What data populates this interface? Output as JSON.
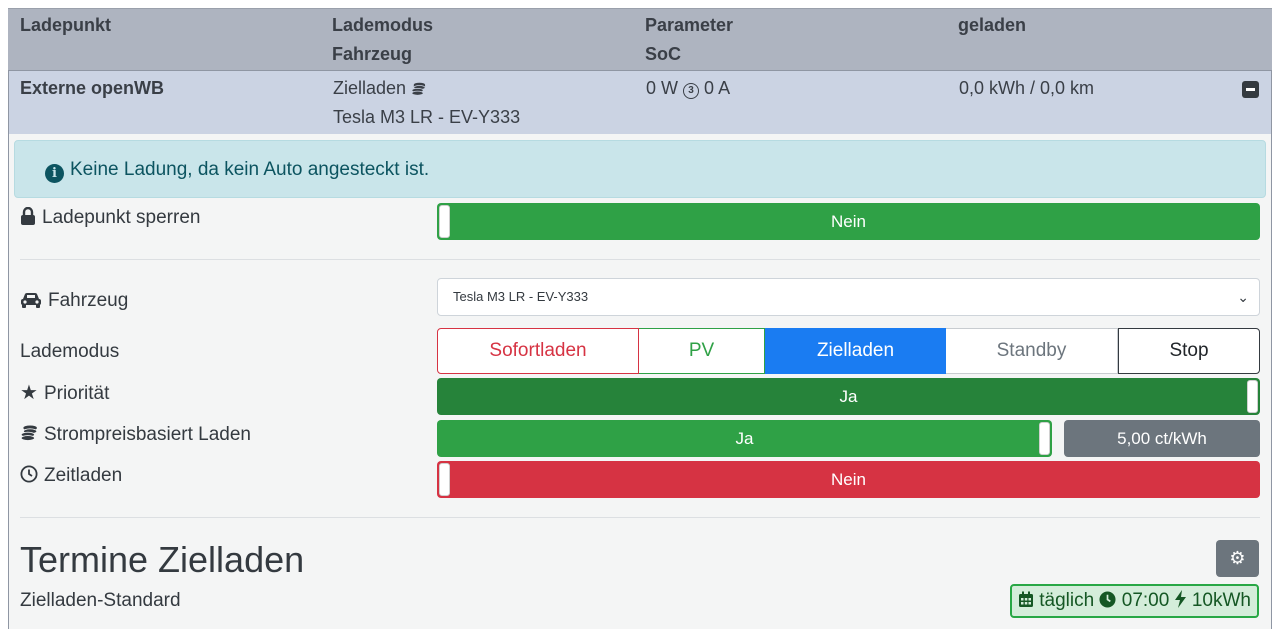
{
  "header": {
    "col1": "Ladepunkt",
    "col2_line1": "Lademodus",
    "col2_line2": "Fahrzeug",
    "col3_line1": "Parameter",
    "col3_line2": "SoC",
    "col4": "geladen"
  },
  "row": {
    "chargepoint": "Externe openWB",
    "mode": "Zielladen",
    "mode_icon": "coins-icon",
    "vehicle": "Tesla M3 LR - EV-Y333",
    "power": "0 W",
    "phases_icon": "3",
    "current": "0 A",
    "charged": "0,0 kWh / 0,0 km"
  },
  "alert": {
    "text": "Keine Ladung, da kein Auto angesteckt ist."
  },
  "settings": {
    "lock_label": "Ladepunkt sperren",
    "lock_value": "Nein",
    "vehicle_label": "Fahrzeug",
    "vehicle_selected": "Tesla M3 LR - EV-Y333",
    "mode_label": "Lademodus",
    "modes": [
      "Sofortladen",
      "PV",
      "Zielladen",
      "Standby",
      "Stop"
    ],
    "mode_active": "Zielladen",
    "priority_label": "Priorität",
    "priority_value": "Ja",
    "price_label": "Strompreisbasiert Laden",
    "price_value": "Ja",
    "price_limit": "5,00 ct/kWh",
    "time_label": "Zeitladen",
    "time_value": "Nein"
  },
  "plans": {
    "title": "Termine Zielladen",
    "subtitle": "Zielladen-Standard",
    "badge_freq": "täglich",
    "badge_time": "07:00",
    "badge_energy": "10kWh"
  },
  "colors": {
    "green": "#2fa146",
    "dark_green": "#26833a",
    "red": "#d63343",
    "blue": "#1a7cf2",
    "gray": "#6c757d"
  }
}
